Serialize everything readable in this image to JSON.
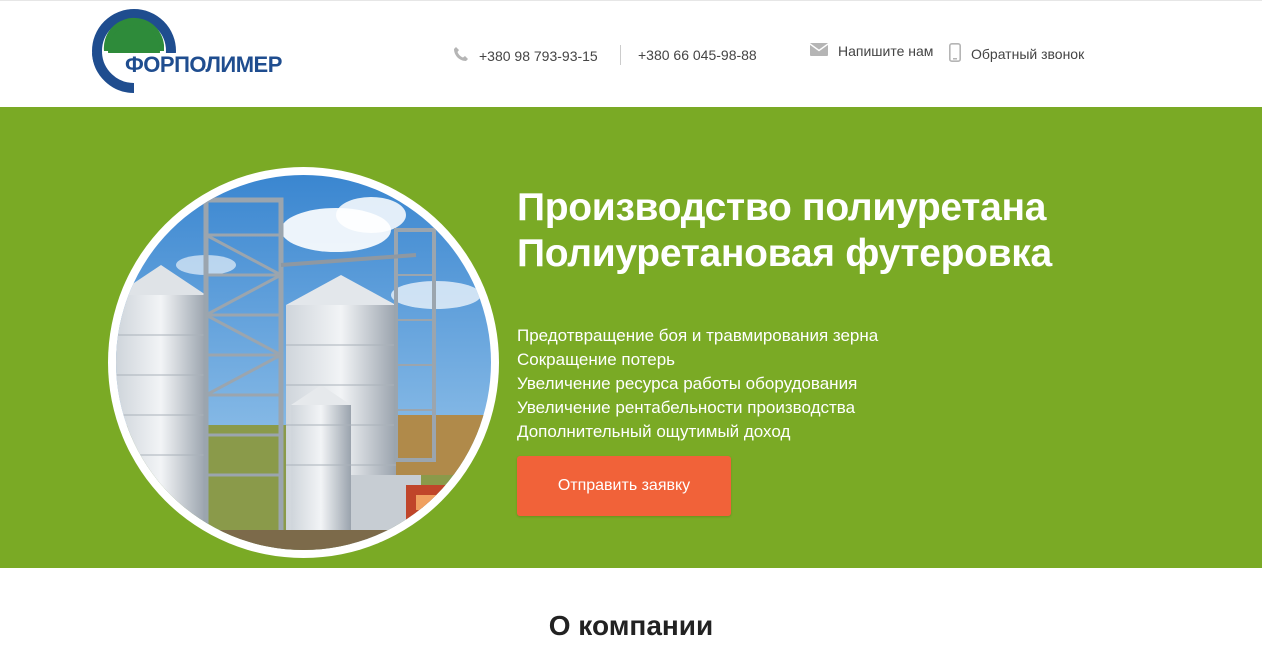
{
  "header": {
    "logo_text": "ФОРПОЛИМЕР",
    "logo_colors": {
      "green": "#2e8b3a",
      "blue": "#1f4d8f"
    },
    "phone_icon": "phone-icon",
    "phone1": "+380 98 793-93-15",
    "phone2": "+380 66 045-98-88",
    "write_icon": "envelope-icon",
    "write_label": "Напишите нам",
    "callback_icon": "mobile-phone-icon",
    "callback_label": "Обратный звонок"
  },
  "hero": {
    "background": "#7aaa25",
    "image": "grain-silo-elevator-photo",
    "title_line1": "Производство полиуретана",
    "title_line2": "Полиуретановая футеровка",
    "benefits": [
      "Предотвращение боя и травмирования зерна",
      "Сокращение потерь",
      "Увеличение ресурса работы оборудования",
      "Увеличение рентабельности производства",
      "Дополнительный ощутимый доход"
    ],
    "cta_label": "Отправить заявку",
    "cta_color": "#f16239"
  },
  "about": {
    "title": "О компании"
  }
}
